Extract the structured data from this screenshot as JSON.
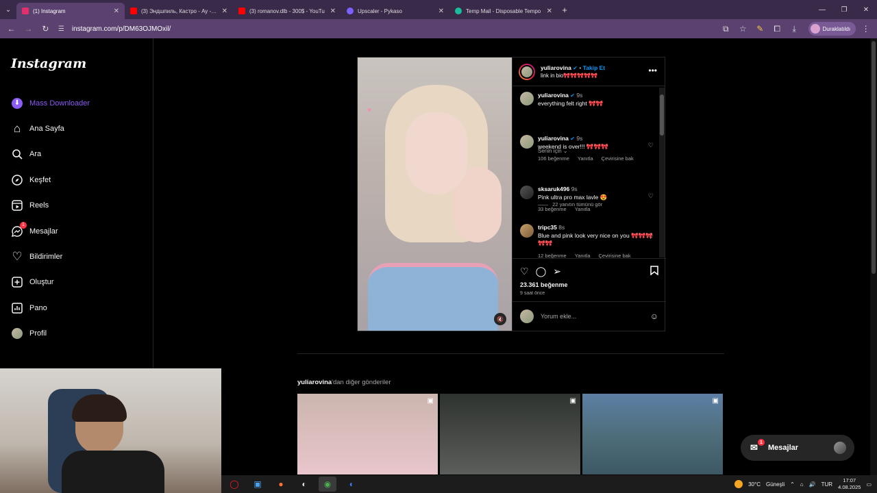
{
  "browser": {
    "tabs": [
      {
        "title": "(1) Instagram",
        "color": "#e1306c",
        "active": true
      },
      {
        "title": "(3) Эндшпиль, Кастро - Ay - Yo",
        "color": "#ff0000",
        "active": false
      },
      {
        "title": "(3) romanov.dlb - 300$ - YouTu",
        "color": "#ff0000",
        "active": false
      },
      {
        "title": "Upscaler - Pykaso",
        "color": "#7b61ff",
        "active": false
      },
      {
        "title": "Temp Mail - Disposable Tempo",
        "color": "#1abc9c",
        "active": false
      }
    ],
    "url": "instagram.com/p/DM63OJMOxil/",
    "profile_label": "Duraklatıldı"
  },
  "sidebar": {
    "logo": "Instagram",
    "items": [
      {
        "label": "Mass Downloader",
        "icon": "download-icon",
        "glyph": "⬇"
      },
      {
        "label": "Ana Sayfa",
        "icon": "home-icon",
        "glyph": "⌂"
      },
      {
        "label": "Ara",
        "icon": "search-icon",
        "glyph": "⚲"
      },
      {
        "label": "Keşfet",
        "icon": "compass-icon",
        "glyph": "◎"
      },
      {
        "label": "Reels",
        "icon": "reels-icon",
        "glyph": "▣"
      },
      {
        "label": "Mesajlar",
        "icon": "messenger-icon",
        "glyph": "✉",
        "badge": "1"
      },
      {
        "label": "Bildirimler",
        "icon": "heart-icon",
        "glyph": "♡"
      },
      {
        "label": "Oluştur",
        "icon": "create-icon",
        "glyph": "⊕"
      },
      {
        "label": "Pano",
        "icon": "dashboard-icon",
        "glyph": "▤"
      },
      {
        "label": "Profil",
        "icon": "profile-icon",
        "glyph": "●"
      }
    ]
  },
  "post": {
    "username": "yuliarovina",
    "follow_label": "Takip Et",
    "dot": "•",
    "bio": "link in bio🎀🎀🎀🎀🎀",
    "caption": {
      "username": "yuliarovina",
      "time": "9s",
      "text": "everything felt right 🎀🎀"
    },
    "for_you": "Senin için",
    "comments": [
      {
        "username": "yuliarovina",
        "time": "9s",
        "text": "weekend is over!!! 🎀🎀🎀",
        "likes": "106 beğenme",
        "reply": "Yanıtla",
        "translate": "Çevirisine bak"
      },
      {
        "username": "sksaruk496",
        "time": "9s",
        "text": "Pink ultra pro max lavle 😍",
        "likes": "33 beğenme",
        "reply": "Yanıtla"
      },
      {
        "username": "tripc35",
        "time": "8s",
        "text": "Blue and pink look very nice on you 🎀🎀🎀🎀🎀",
        "likes": "12 beğenme",
        "reply": "Yanıtla",
        "translate": "Çevirisine bak"
      }
    ],
    "view_replies": "22 yanıtın tümünü gör",
    "like_count": "23.361 beğenme",
    "posted_ago": "9 saat önce",
    "add_comment_placeholder": "Yorum ekle..."
  },
  "more_posts": {
    "username": "yuliarovina",
    "suffix": "'dan diğer gönderiler"
  },
  "messages_button": {
    "label": "Mesajlar",
    "badge": "1"
  },
  "taskbar": {
    "weather": "30°C",
    "weather_desc": "Güneşli",
    "lang": "TUR",
    "time": "17:07",
    "date": "4.08.2025"
  }
}
